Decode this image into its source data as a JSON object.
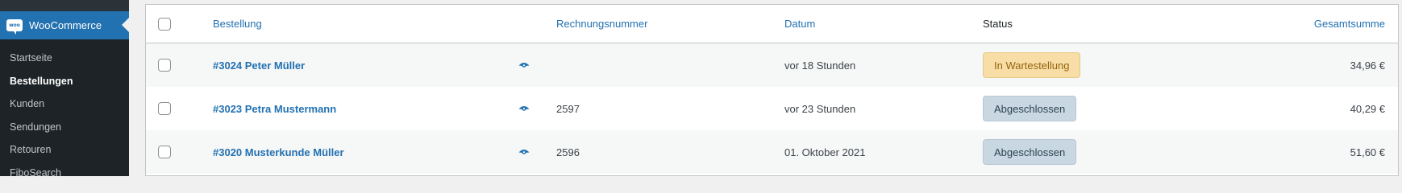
{
  "sidebar": {
    "menu_title": "WooCommerce",
    "logo_text": "woo",
    "items": [
      {
        "label": "Startseite",
        "current": false
      },
      {
        "label": "Bestellungen",
        "current": true
      },
      {
        "label": "Kunden",
        "current": false
      },
      {
        "label": "Sendungen",
        "current": false
      },
      {
        "label": "Retouren",
        "current": false
      },
      {
        "label": "FiboSearch",
        "current": false
      }
    ]
  },
  "table": {
    "headers": {
      "order": "Bestellung",
      "invoice": "Rechnungsnummer",
      "date": "Datum",
      "status": "Status",
      "total": "Gesamtsumme"
    },
    "rows": [
      {
        "order": "#3024 Peter Müller",
        "invoice": "",
        "date": "vor 18 Stunden",
        "status": "In Wartestellung",
        "status_type": "on-hold",
        "total": "34,96 €"
      },
      {
        "order": "#3023 Petra Mustermann",
        "invoice": "2597",
        "date": "vor 23 Stunden",
        "status": "Abgeschlossen",
        "status_type": "completed",
        "total": "40,29 €"
      },
      {
        "order": "#3020 Musterkunde Müller",
        "invoice": "2596",
        "date": "01. Oktober 2021",
        "status": "Abgeschlossen",
        "status_type": "completed",
        "total": "51,60 €"
      }
    ]
  },
  "colors": {
    "sidebar_bg": "#1d2327",
    "accent": "#2271b1",
    "on_hold_bg": "#f8dda7",
    "completed_bg": "#c8d7e1"
  },
  "icons": {
    "preview": "eye-icon"
  }
}
